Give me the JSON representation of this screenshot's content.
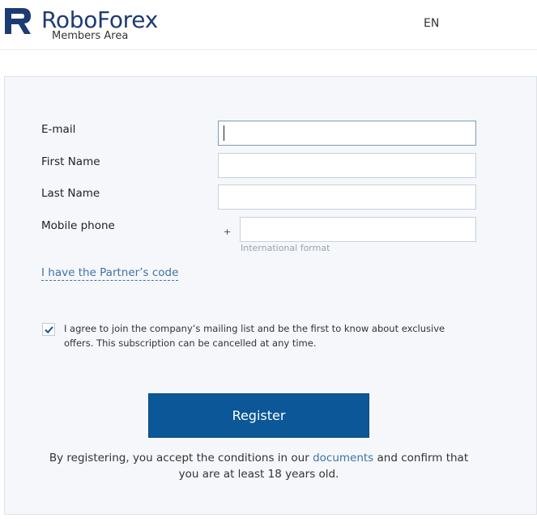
{
  "header": {
    "logo_icon": "roboforex-r-logo-icon",
    "brand": "RoboForex",
    "subtitle": "Members Area",
    "language": "EN"
  },
  "form": {
    "email_label": "E-mail",
    "email_value": "",
    "first_name_label": "First Name",
    "first_name_value": "",
    "last_name_label": "Last Name",
    "last_name_value": "",
    "phone_label": "Mobile phone",
    "phone_prefix": "+",
    "phone_value": "",
    "phone_hint": "International format",
    "partner_link": "I have the Partner’s code",
    "agree_checked": true,
    "agree_text": "I agree to join the company’s mailing list and be the first to know about exclusive offers. This subscription can be cancelled at any time.",
    "register_label": "Register",
    "terms_before": "By registering, you accept the conditions in our ",
    "terms_link": "documents",
    "terms_after": " and confirm that you are at least 18 years old."
  },
  "colors": {
    "brand": "#1d3b73",
    "button": "#0b5797",
    "link": "#3e73a8",
    "panel_bg": "#f5f7fa"
  }
}
